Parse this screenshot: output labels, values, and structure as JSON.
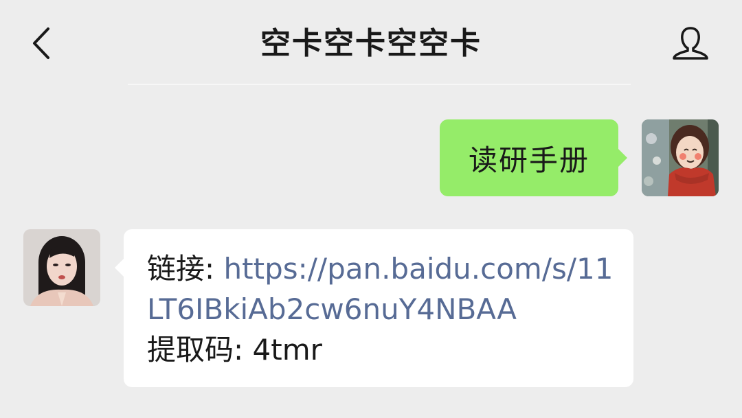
{
  "header": {
    "title": "空卡空卡空空卡",
    "back_icon": "chevron-left-icon",
    "profile_icon": "person-icon"
  },
  "messages": {
    "outgoing": {
      "text": "读研手册"
    },
    "incoming": {
      "link_label": "链接: ",
      "link_url_line1": "https://pan.baidu.com/s/11",
      "link_url_line2": "LT6IBkiAb2cw6nuY4NBAA",
      "code_label": "提取码: ",
      "code_value": "4tmr"
    }
  },
  "colors": {
    "background": "#ededed",
    "outgoing_bubble": "#95ec69",
    "incoming_bubble": "#ffffff",
    "link": "#576b95",
    "text": "#191919"
  }
}
